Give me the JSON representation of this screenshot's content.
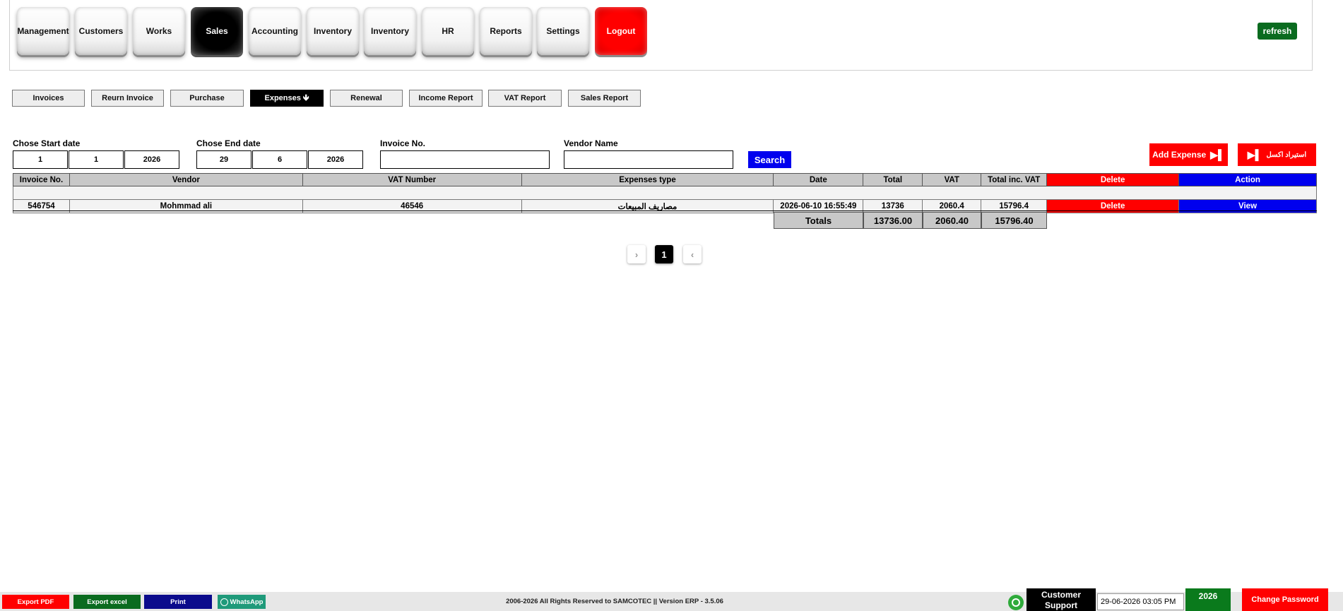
{
  "nav": {
    "items": [
      {
        "label": "Management"
      },
      {
        "label": "Customers"
      },
      {
        "label": "Works"
      },
      {
        "label": "Sales"
      },
      {
        "label": "Accounting"
      },
      {
        "label": "Inventory"
      },
      {
        "label": "Inventory"
      },
      {
        "label": "HR"
      },
      {
        "label": "Reports"
      },
      {
        "label": "Settings"
      },
      {
        "label": "Logout"
      }
    ],
    "active_item": "Sales",
    "refresh_label": "refresh"
  },
  "subnav": {
    "items": [
      {
        "label": "Invoices"
      },
      {
        "label": "Reurn Invoice"
      },
      {
        "label": "Purchase"
      },
      {
        "label": "Expenses"
      },
      {
        "label": "Renewal"
      },
      {
        "label": "Income Report"
      },
      {
        "label": "VAT Report"
      },
      {
        "label": "Sales Report"
      }
    ],
    "active_item": "Expenses"
  },
  "filters": {
    "start_label": "Chose Start date",
    "start_day": "1",
    "start_month": "1",
    "start_year": "2026",
    "end_label": "Chose End date",
    "end_day": "29",
    "end_month": "6",
    "end_year": "2026",
    "invoice_label": "Invoice No.",
    "invoice_value": "",
    "vendor_label": "Vendor Name",
    "vendor_value": "",
    "search_label": "Search"
  },
  "actions": {
    "add_expense_label": "Add Expense",
    "import_excel_label": "استيراد اكسل"
  },
  "table": {
    "headers": [
      "Invoice No.",
      "Vendor",
      "VAT Number",
      "Expenses type",
      "Date",
      "Total",
      "VAT",
      "Total inc. VAT",
      "Delete",
      "Action"
    ],
    "rows": [
      {
        "invoice_no": "546754",
        "vendor": "Mohmmad ali",
        "vat_number": "46546",
        "expense_type": "مصاريف المبيعات",
        "date": "2026-06-10 16:55:49",
        "total": "13736",
        "vat": "2060.4",
        "total_inc_vat": "15796.4",
        "delete_label": "Delete",
        "action_label": "View"
      }
    ],
    "totals": {
      "label": "Totals",
      "total": "13736.00",
      "vat": "2060.40",
      "total_inc_vat": "15796.40"
    }
  },
  "pagination": {
    "current_page": "1"
  },
  "footer": {
    "export_pdf": "Export PDF",
    "export_excel": "Export excel",
    "print": "Print",
    "whatsapp": "WhatsApp",
    "copyright": "2006-2026 All Rights Reserved to SAMCOTEC || Version ERP - 3.5.06",
    "support_label": "Customer Support",
    "datetime": "29-06-2026 03:05 PM",
    "year": "2026",
    "change_password": "Change Password"
  },
  "colors": {
    "accent_red": "#ff0000",
    "accent_blue": "#0000ee",
    "accent_green": "#0a6b1f",
    "active_black": "#000000"
  }
}
